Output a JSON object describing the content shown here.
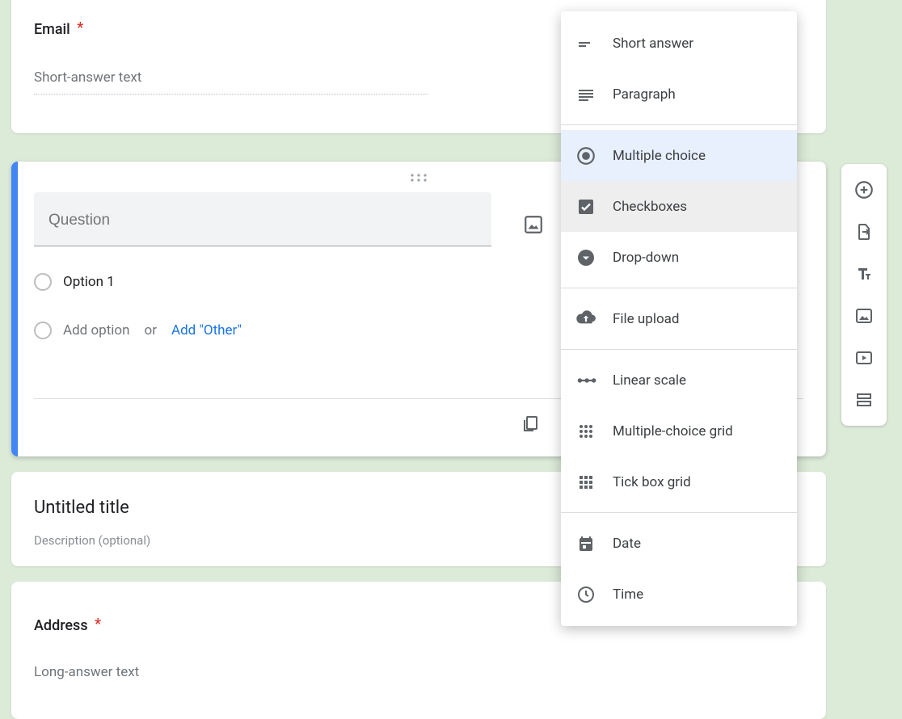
{
  "email_card": {
    "label": "Email",
    "required": true,
    "placeholder": "Short-answer text"
  },
  "question_card": {
    "question_placeholder": "Question",
    "option1": "Option 1",
    "add_option": "Add option",
    "or": "or",
    "add_other": "Add \"Other\""
  },
  "section_card": {
    "title": "Untitled title",
    "description": "Description (optional)"
  },
  "address_card": {
    "label": "Address",
    "required": true,
    "placeholder": "Long-answer text"
  },
  "type_menu": {
    "short_answer": "Short answer",
    "paragraph": "Paragraph",
    "multiple_choice": "Multiple choice",
    "checkboxes": "Checkboxes",
    "dropdown": "Drop-down",
    "file_upload": "File upload",
    "linear_scale": "Linear scale",
    "mc_grid": "Multiple-choice grid",
    "tick_grid": "Tick box grid",
    "date": "Date",
    "time": "Time"
  },
  "side_toolbar": {
    "add_question": "add-question",
    "import": "import-questions",
    "title": "add-title",
    "image": "add-image",
    "video": "add-video",
    "section": "add-section"
  }
}
